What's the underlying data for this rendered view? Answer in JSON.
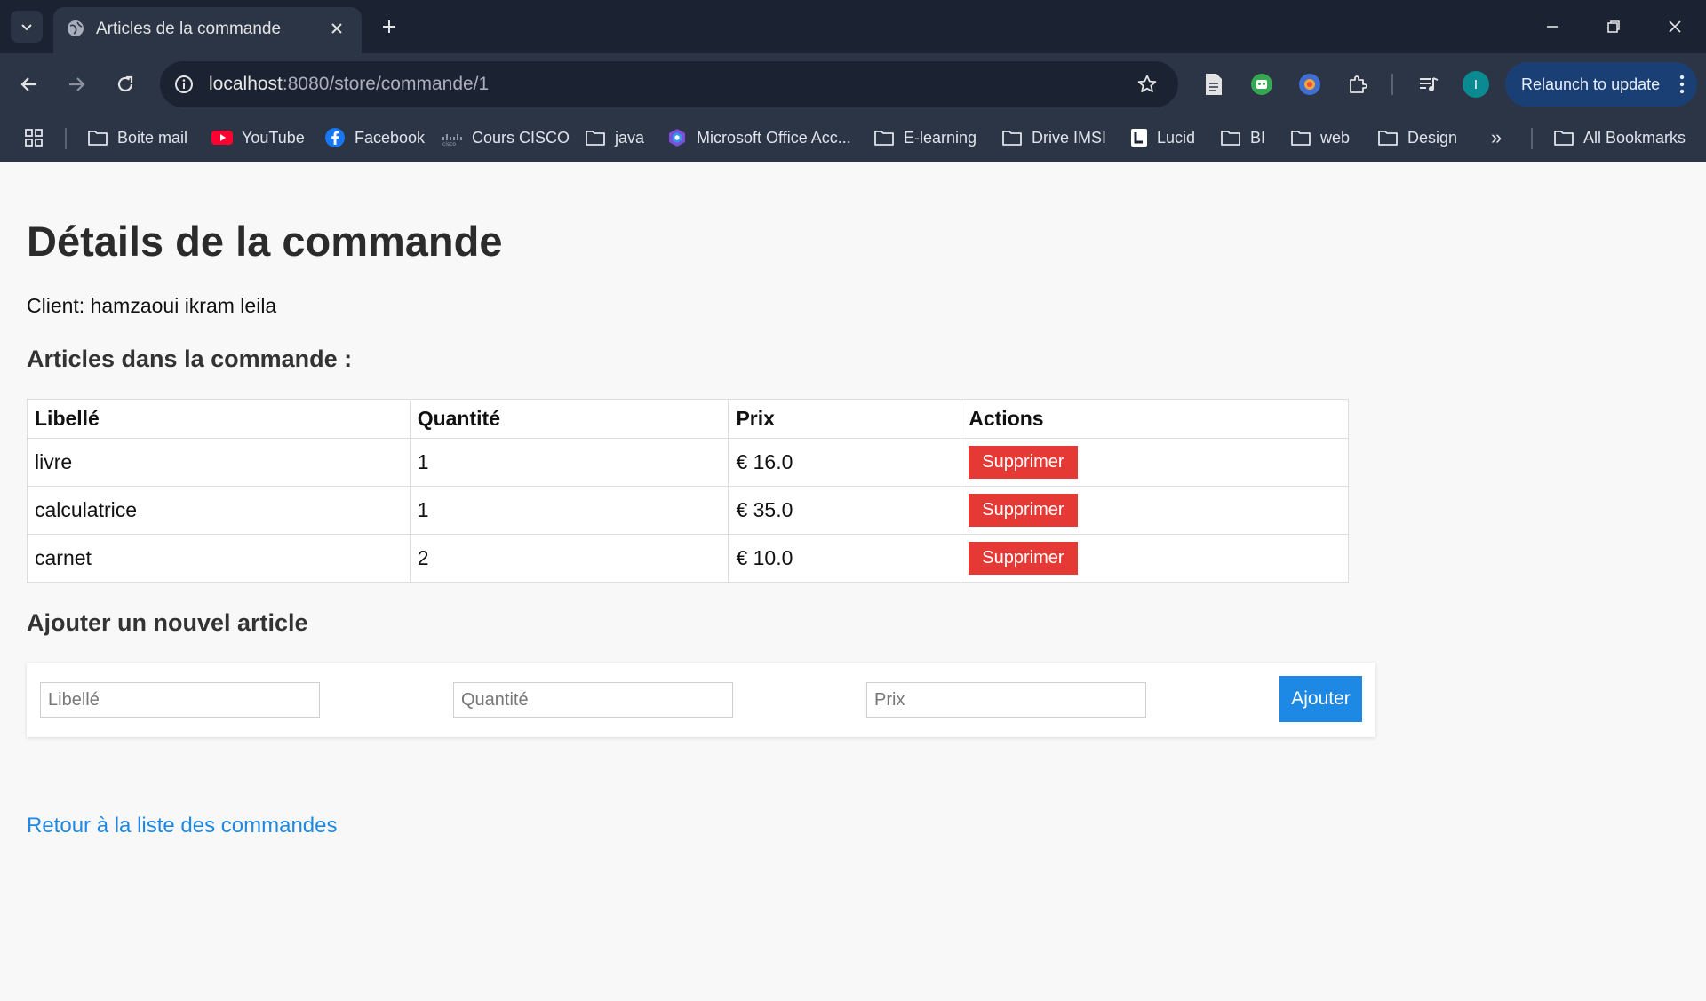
{
  "browser": {
    "tab_title": "Articles de la commande",
    "url_host": "localhost",
    "url_path": ":8080/store/commande/1",
    "relaunch_label": "Relaunch to update",
    "profile_initial": "I",
    "bookmarks": [
      {
        "label": "Boite mail",
        "icon": "folder-icon"
      },
      {
        "label": "YouTube",
        "icon": "youtube-icon"
      },
      {
        "label": "Facebook",
        "icon": "facebook-icon"
      },
      {
        "label": "Cours CISCO",
        "icon": "cisco-icon"
      },
      {
        "label": "java",
        "icon": "folder-icon"
      },
      {
        "label": "Microsoft Office Acc...",
        "icon": "office-icon"
      },
      {
        "label": "E-learning",
        "icon": "folder-icon"
      },
      {
        "label": "Drive IMSI",
        "icon": "folder-icon"
      },
      {
        "label": "Lucid",
        "icon": "lucid-icon"
      },
      {
        "label": "BI",
        "icon": "folder-icon"
      },
      {
        "label": "web",
        "icon": "folder-icon"
      },
      {
        "label": "Design",
        "icon": "folder-icon"
      }
    ],
    "more_bookmarks": "»",
    "all_bookmarks": "All Bookmarks"
  },
  "page": {
    "title": "Détails de la commande",
    "client": "Client: hamzaoui ikram leila",
    "items_heading": "Articles dans la commande :",
    "table": {
      "headers": [
        "Libellé",
        "Quantité",
        "Prix",
        "Actions"
      ],
      "rows": [
        {
          "libelle": "livre",
          "quantite": "1",
          "prix": "€ 16.0",
          "action": "Supprimer"
        },
        {
          "libelle": "calculatrice",
          "quantite": "1",
          "prix": "€ 35.0",
          "action": "Supprimer"
        },
        {
          "libelle": "carnet",
          "quantite": "2",
          "prix": "€ 10.0",
          "action": "Supprimer"
        }
      ]
    },
    "add_heading": "Ajouter un nouvel article",
    "form": {
      "libelle_placeholder": "Libellé",
      "quantite_placeholder": "Quantité",
      "prix_placeholder": "Prix",
      "submit_label": "Ajouter"
    },
    "back_link": "Retour à la liste des commandes"
  },
  "colors": {
    "delete_button": "#e53935",
    "primary": "#1e88e5",
    "chrome_dark": "#1b2231",
    "chrome": "#2c3546"
  }
}
